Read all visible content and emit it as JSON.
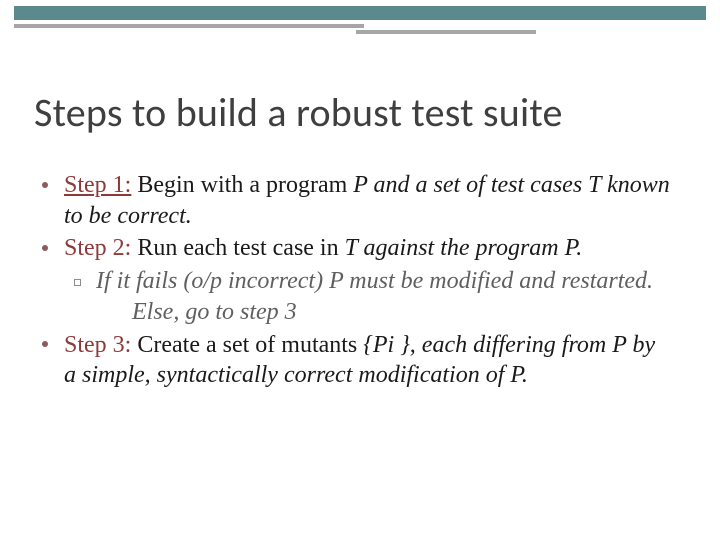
{
  "title": "Steps to build a robust test suite",
  "steps": {
    "s1": {
      "label": "Step 1:",
      "text_a": " Begin with a program ",
      "text_b": "P and a set of test cases T known to be correct."
    },
    "s2": {
      "label": "Step 2:",
      "text_a": " Run each test case in ",
      "text_b": "T against the program P."
    },
    "sub": {
      "text_a": "If it fails (o/p incorrect) P must be modified and restarted.",
      "text_b": "Else, go to step 3"
    },
    "s3": {
      "label": "Step 3:",
      "text_a": " Create a set of mutants ",
      "text_b": "{Pi }, each differing from P by a simple, syntactically correct modification of P."
    }
  }
}
